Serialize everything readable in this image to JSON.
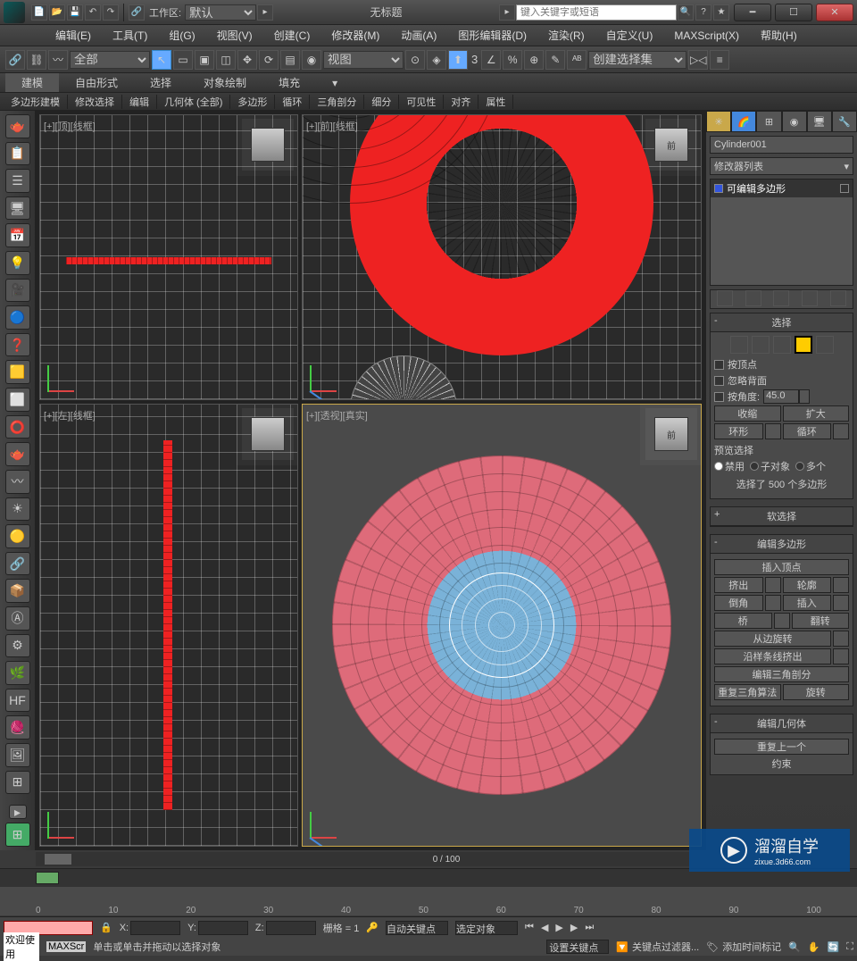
{
  "titlebar": {
    "workspace_label": "工作区: ",
    "workspace_value": "默认",
    "title": "无标题",
    "search_placeholder": "键入关键字或短语"
  },
  "menus": [
    "编辑(E)",
    "工具(T)",
    "组(G)",
    "视图(V)",
    "创建(C)",
    "修改器(M)",
    "动画(A)",
    "图形编辑器(D)",
    "渲染(R)",
    "自定义(U)",
    "MAXScript(X)",
    "帮助(H)"
  ],
  "toolbar": {
    "layer_sel": "全部",
    "view_sel": "视图",
    "create_set": "创建选择集"
  },
  "ribbon_tabs": [
    "建模",
    "自由形式",
    "选择",
    "对象绘制",
    "填充"
  ],
  "ribbon_sub": [
    "多边形建模",
    "修改选择",
    "编辑",
    "几何体 (全部)",
    "多边形",
    "循环",
    "三角剖分",
    "细分",
    "可见性",
    "对齐",
    "属性"
  ],
  "viewports": {
    "top": "[+][顶][线框]",
    "front": "[+][前][线框]",
    "left": "[+][左][线框]",
    "persp": "[+][透视][真实]",
    "cube_front": "前"
  },
  "panel": {
    "object_name": "Cylinder001",
    "modlist_label": "修改器列表",
    "stack_item": "可编辑多边形",
    "rollout_select": "选择",
    "chk_vertex": "按顶点",
    "chk_backface": "忽略背面",
    "chk_angle": "按角度:",
    "angle_value": "45.0",
    "btn_shrink": "收缩",
    "btn_grow": "扩大",
    "btn_ring": "环形",
    "btn_loop": "循环",
    "preview_label": "预览选择",
    "r_disable": "禁用",
    "r_subobj": "子对象",
    "r_multi": "多个",
    "sel_count": "选择了 500 个多边形",
    "rollout_soft": "软选择",
    "rollout_editpoly": "编辑多边形",
    "btn_insert_vert": "插入顶点",
    "btn_extrude": "挤出",
    "btn_outline": "轮廓",
    "btn_bevel": "倒角",
    "btn_inset": "插入",
    "btn_bridge": "桥",
    "btn_flip": "翻转",
    "btn_hinge": "从边旋转",
    "btn_extspline": "沿样条线挤出",
    "btn_edittri": "编辑三角剖分",
    "btn_retri": "重复三角算法",
    "btn_turn": "旋转",
    "rollout_editgeo": "编辑几何体",
    "btn_repeat": "重复上一个",
    "constraint": "约束"
  },
  "timeline": {
    "frame_label": "0 / 100",
    "ticks": [
      "0",
      "10",
      "20",
      "30",
      "40",
      "50",
      "60",
      "70",
      "80",
      "90",
      "100"
    ]
  },
  "status": {
    "x": "X:",
    "y": "Y:",
    "z": "Z:",
    "grid": "栅格 = 1",
    "autokey": "自动关键点",
    "selobj": "选定对象",
    "setkey": "设置关键点",
    "keyfilter": "关键点过滤器...",
    "welcome": "欢迎使用",
    "maxscr": "MAXScr",
    "prompt": "单击或单击并拖动以选择对象",
    "addtag": "添加时间标记"
  },
  "watermark": {
    "brand": "溜溜自学",
    "url": "zixue.3d66.com"
  }
}
